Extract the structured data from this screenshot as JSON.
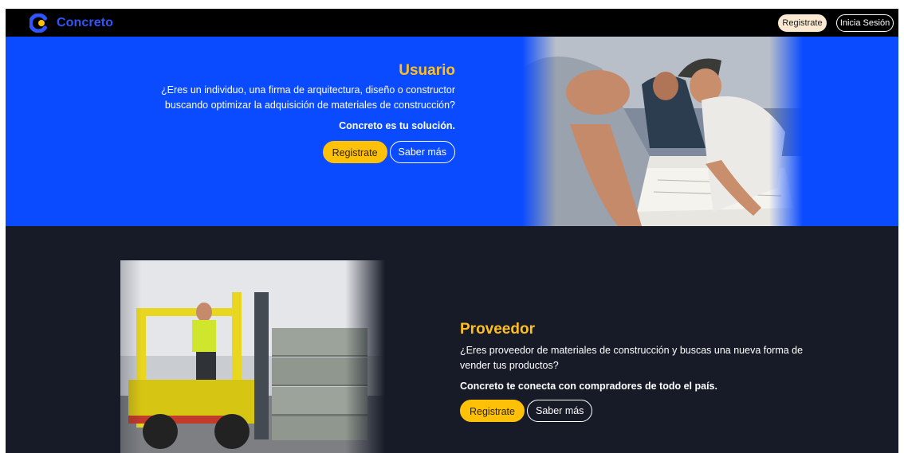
{
  "nav": {
    "brand": "Concreto",
    "register_label": "Registrate",
    "login_label": "Inicia Sesión"
  },
  "user_section": {
    "title": "Usuario",
    "description": "¿Eres un individuo, una firma de arquitectura, diseño o constructor buscando optimizar la adquisición de materiales de construcción?",
    "highlight": "Concreto es tu solución.",
    "register_label": "Registrate",
    "more_label": "Saber más"
  },
  "provider_section": {
    "title": "Proveedor",
    "description": "¿Eres proveedor de materiales de construcción y buscas una nueva forma de vender tus productos?",
    "highlight": "Concreto te conecta con compradores de todo el país.",
    "register_label": "Registrate",
    "more_label": "Saber más"
  },
  "colors": {
    "brand_blue": "#0a4bff",
    "accent_yellow": "#ffc107",
    "dark_bg": "#161b27"
  },
  "images": {
    "user_photo": "workers-reviewing-blueprints-photo",
    "provider_photo": "forklift-operator-photo"
  }
}
